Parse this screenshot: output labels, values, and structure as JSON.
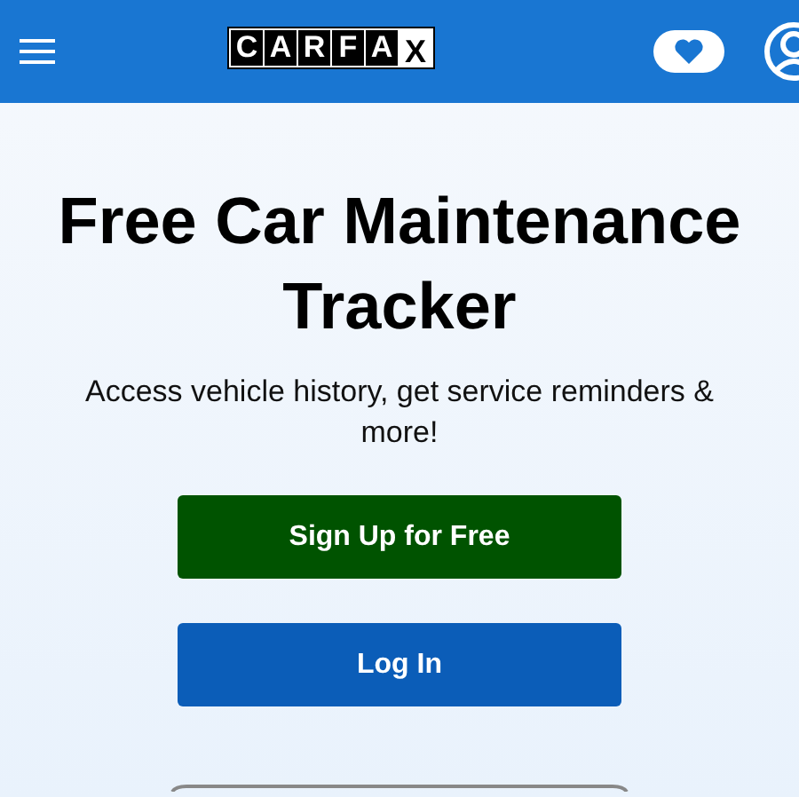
{
  "header": {
    "logo_letters": [
      "C",
      "A",
      "R",
      "F",
      "A",
      "X"
    ]
  },
  "hero": {
    "title": "Free Car Maintenance Tracker",
    "subtitle": "Access vehicle history, get service reminders & more!"
  },
  "buttons": [
    {
      "label": "Sign Up for Free",
      "kind": "primary"
    },
    {
      "label": "Log In",
      "kind": "secondary"
    }
  ]
}
